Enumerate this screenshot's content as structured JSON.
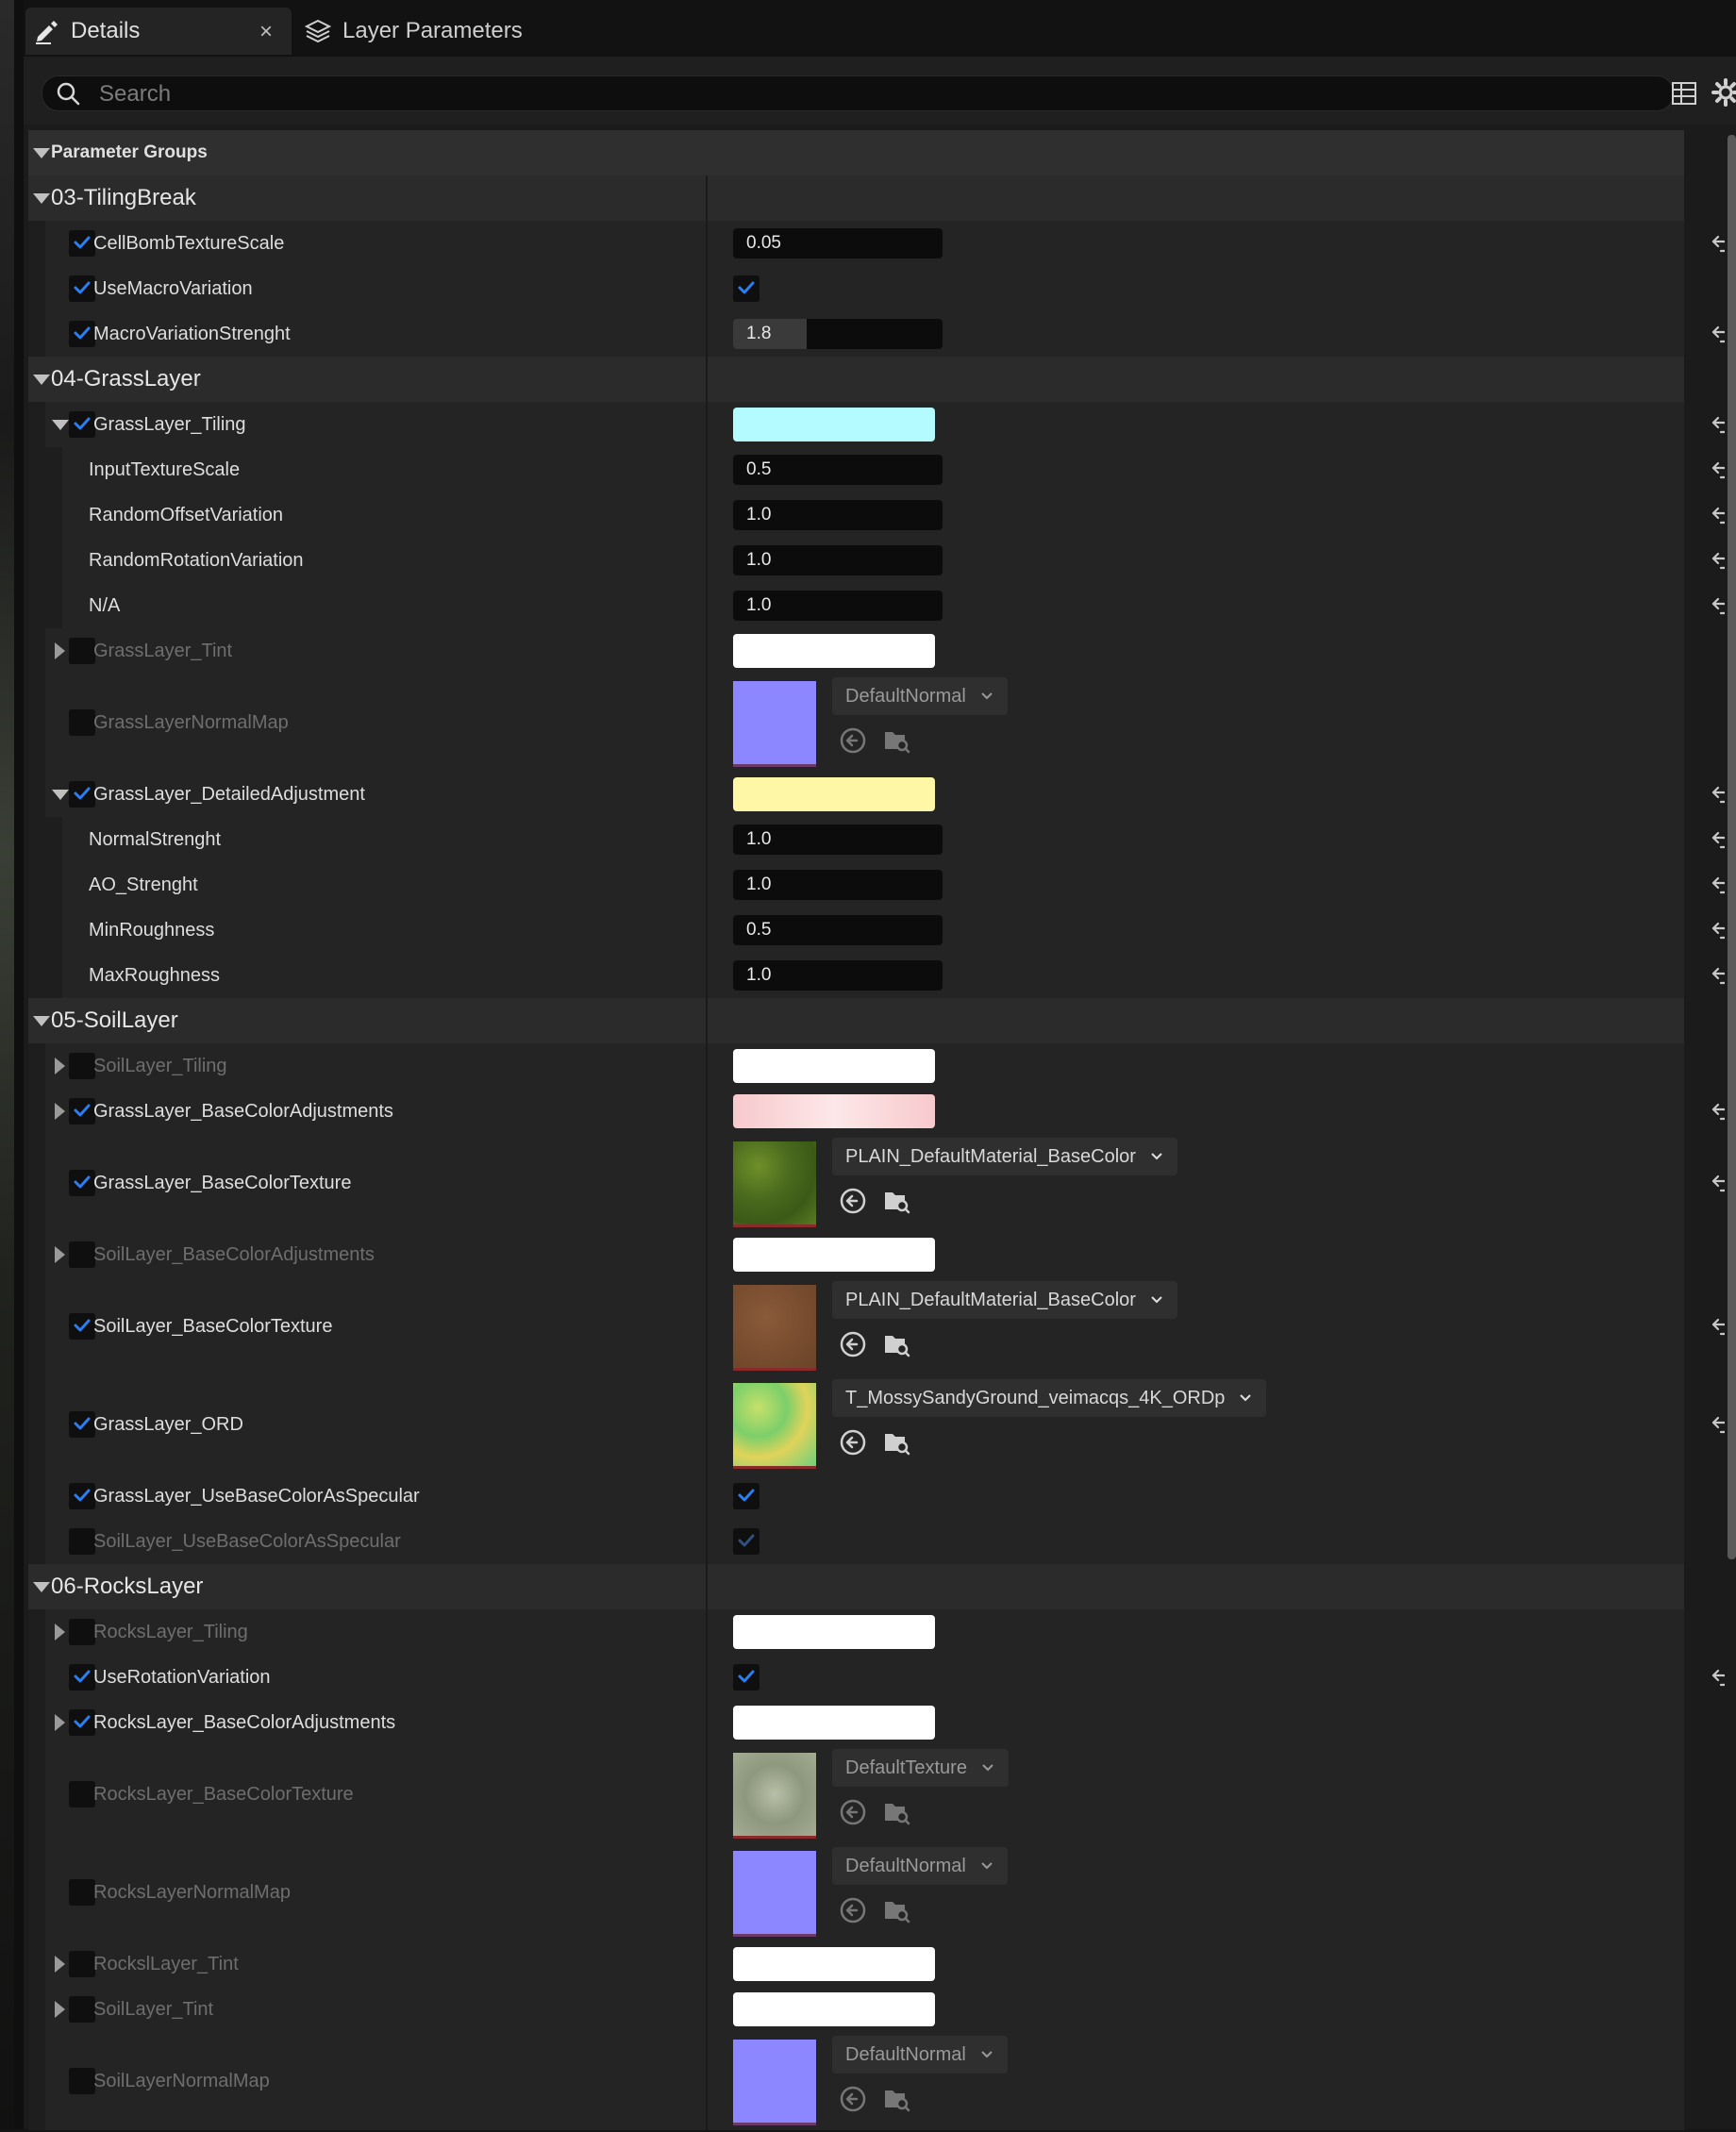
{
  "tabs": [
    {
      "label": "Details",
      "icon": "pencil-icon",
      "active": true,
      "close": "×"
    },
    {
      "label": "Layer Parameters",
      "icon": "layers-icon",
      "active": false
    }
  ],
  "search": {
    "placeholder": "Search",
    "value": ""
  },
  "rows": [
    {
      "kind": "top",
      "label": "Parameter Groups",
      "expanded": true
    },
    {
      "kind": "group",
      "label": "03-TilingBreak",
      "expanded": true
    },
    {
      "kind": "param",
      "label": "CellBombTextureScale",
      "checked": true,
      "enabled": true,
      "value": "0.05",
      "reset": true
    },
    {
      "kind": "param",
      "label": "UseMacroVariation",
      "checked": true,
      "enabled": true,
      "bool": true
    },
    {
      "kind": "param",
      "label": "MacroVariationStrenght",
      "checked": true,
      "enabled": true,
      "value": "1.8",
      "fill": 0.35,
      "reset": true
    },
    {
      "kind": "group",
      "label": "04-GrassLayer",
      "expanded": true
    },
    {
      "kind": "param",
      "label": "GrassLayer_Tiling",
      "checked": true,
      "enabled": true,
      "expand": "down",
      "swatch": "#b4fbff",
      "reset": true
    },
    {
      "kind": "sub",
      "label": "InputTextureScale",
      "value": "0.5",
      "reset": true
    },
    {
      "kind": "sub",
      "label": "RandomOffsetVariation",
      "value": "1.0",
      "reset": true
    },
    {
      "kind": "sub",
      "label": "RandomRotationVariation",
      "value": "1.0",
      "reset": true
    },
    {
      "kind": "sub",
      "label": "N/A",
      "value": "1.0",
      "reset": true
    },
    {
      "kind": "param",
      "label": "GrassLayer_Tint",
      "checked": false,
      "enabled": false,
      "expand": "right",
      "swatch": "#ffffff"
    },
    {
      "kind": "param",
      "label": "GrassLayerNormalMap",
      "checked": false,
      "enabled": false,
      "tall": true,
      "texture": "normal",
      "asset": "DefaultNormal"
    },
    {
      "kind": "param",
      "label": "GrassLayer_DetailedAdjustment",
      "checked": true,
      "enabled": true,
      "expand": "down",
      "swatch": "#fdf7a6",
      "reset": true
    },
    {
      "kind": "sub",
      "label": "NormalStrenght",
      "value": "1.0",
      "reset": true
    },
    {
      "kind": "sub",
      "label": "AO_Strenght",
      "value": "1.0",
      "reset": true
    },
    {
      "kind": "sub",
      "label": "MinRoughness",
      "value": "0.5",
      "reset": true
    },
    {
      "kind": "sub",
      "label": "MaxRoughness",
      "value": "1.0",
      "reset": true
    },
    {
      "kind": "group",
      "label": "05-SoilLayer",
      "expanded": true
    },
    {
      "kind": "param",
      "label": "SoilLayer_Tiling",
      "checked": false,
      "enabled": false,
      "expand": "right",
      "swatch": "#ffffff"
    },
    {
      "kind": "param",
      "label": "GrassLayer_BaseColorAdjustments",
      "checked": true,
      "enabled": true,
      "expand": "right",
      "swatch": "pink",
      "reset": true
    },
    {
      "kind": "param",
      "label": "GrassLayer_BaseColorTexture",
      "checked": true,
      "enabled": true,
      "tall": true,
      "texture": "grass",
      "asset": "PLAIN_DefaultMaterial_BaseColor",
      "reset": true
    },
    {
      "kind": "param",
      "label": "SoilLayer_BaseColorAdjustments",
      "checked": false,
      "enabled": false,
      "expand": "right",
      "swatch": "#ffffff"
    },
    {
      "kind": "param",
      "label": "SoilLayer_BaseColorTexture",
      "checked": true,
      "enabled": true,
      "tall": true,
      "texture": "soil",
      "asset": "PLAIN_DefaultMaterial_BaseColor",
      "reset": true
    },
    {
      "kind": "param",
      "label": "GrassLayer_ORD",
      "checked": true,
      "enabled": true,
      "tall": true,
      "texture": "ord",
      "asset": "T_MossySandyGround_veimacqs_4K_ORDp",
      "reset": true
    },
    {
      "kind": "param",
      "label": "GrassLayer_UseBaseColorAsSpecular",
      "checked": true,
      "enabled": true,
      "bool": true
    },
    {
      "kind": "param",
      "label": "SoilLayer_UseBaseColorAsSpecular",
      "checked": false,
      "enabled": false,
      "bool": true,
      "boolDim": true
    },
    {
      "kind": "group",
      "label": "06-RocksLayer",
      "expanded": true
    },
    {
      "kind": "param",
      "label": "RocksLayer_Tiling",
      "checked": false,
      "enabled": false,
      "expand": "right",
      "swatch": "#ffffff"
    },
    {
      "kind": "param",
      "label": "UseRotationVariation",
      "checked": true,
      "enabled": true,
      "bool": true,
      "reset": true
    },
    {
      "kind": "param",
      "label": "RocksLayer_BaseColorAdjustments",
      "checked": true,
      "enabled": true,
      "expand": "right",
      "swatch": "#ffffff"
    },
    {
      "kind": "param",
      "label": "RocksLayer_BaseColorTexture",
      "checked": false,
      "enabled": false,
      "tall": true,
      "texture": "rock",
      "asset": "DefaultTexture"
    },
    {
      "kind": "param",
      "label": "RocksLayerNormalMap",
      "checked": false,
      "enabled": false,
      "tall": true,
      "texture": "normal",
      "asset": "DefaultNormal"
    },
    {
      "kind": "param",
      "label": "RockslLayer_Tint",
      "checked": false,
      "enabled": false,
      "expand": "right",
      "swatch": "#ffffff"
    },
    {
      "kind": "param",
      "label": "SoilLayer_Tint",
      "checked": false,
      "enabled": false,
      "expand": "right",
      "swatch": "#ffffff"
    },
    {
      "kind": "param",
      "label": "SoilLayerNormalMap",
      "checked": false,
      "enabled": false,
      "tall": true,
      "texture": "normal",
      "asset": "DefaultNormal"
    }
  ],
  "colors": {
    "accent": "#1f6ee6",
    "normal_map": "#8c86ff",
    "grass_tiling": "#b4fbff",
    "detail_adjust": "#fdf7a6"
  },
  "icons": {
    "search": "search-icon",
    "table": "table-view-icon",
    "settings": "gear-icon",
    "reset": "reset-to-default-icon",
    "use_selected": "use-selected-asset-icon",
    "browse": "browse-asset-icon"
  }
}
